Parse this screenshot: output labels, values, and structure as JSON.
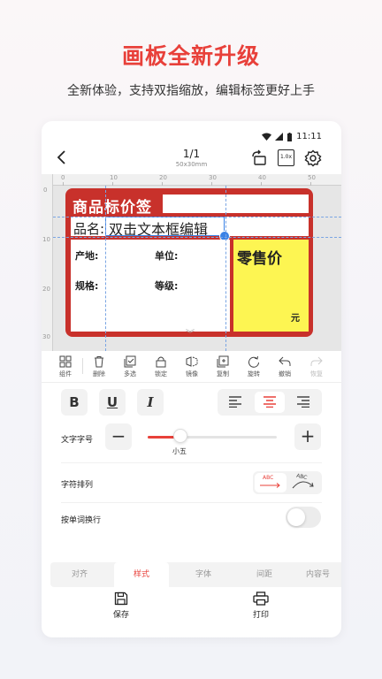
{
  "promo": {
    "headline": "画板全新升级",
    "subhead": "全新体验，支持双指缩放，编辑标签更好上手"
  },
  "status_bar": {
    "time": "11:11"
  },
  "topbar": {
    "page": "1/1",
    "size": "50x30mm",
    "zoom_badge": "1.0x",
    "icons": [
      "back-icon",
      "replace-template-icon",
      "zoom-level-icon",
      "settings-gear-icon"
    ]
  },
  "rulers": {
    "top": [
      "0",
      "10",
      "20",
      "30",
      "40",
      "50"
    ],
    "left": [
      "0",
      "10",
      "20",
      "30"
    ]
  },
  "label": {
    "title": "商品标价签",
    "name_label": "品名:",
    "editing_text": "双击文本框编辑",
    "fields": {
      "origin": "产地:",
      "unit": "单位:",
      "spec": "规格:",
      "grade": "等级:"
    },
    "price_title": "零售价",
    "price_unit": "元",
    "colors": {
      "frame": "#c8312b",
      "price_bg": "#fdf552",
      "selection": "#3a82e6"
    }
  },
  "toolbar": {
    "items": [
      {
        "label": "组件",
        "icon": "components-grid-icon",
        "enabled": true
      },
      {
        "label": "删除",
        "icon": "trash-icon",
        "enabled": true
      },
      {
        "label": "多选",
        "icon": "multi-select-icon",
        "enabled": true
      },
      {
        "label": "锁定",
        "icon": "lock-icon",
        "enabled": true
      },
      {
        "label": "镜像",
        "icon": "mirror-icon",
        "enabled": true
      },
      {
        "label": "复制",
        "icon": "copy-icon",
        "enabled": true
      },
      {
        "label": "旋转",
        "icon": "rotate-icon",
        "enabled": true
      },
      {
        "label": "撤销",
        "icon": "undo-icon",
        "enabled": true
      },
      {
        "label": "恢复",
        "icon": "redo-icon",
        "enabled": false
      }
    ]
  },
  "format": {
    "bold": "B",
    "underline": "U",
    "italic": "I",
    "alignment_selected": "center"
  },
  "font_size": {
    "label": "文字字号",
    "value": "小五",
    "level": 0.25,
    "minus": "−",
    "plus": "+"
  },
  "arrangement": {
    "label": "字符排列",
    "options": [
      "ABC",
      "ABC"
    ],
    "selected": "horizontal"
  },
  "word_wrap": {
    "label": "按单词换行",
    "enabled": false
  },
  "tabs": {
    "items": [
      "对齐",
      "样式",
      "字体",
      "间距",
      "内容号"
    ],
    "active": "样式"
  },
  "bottom_actions": {
    "save": "保存",
    "print": "打印"
  },
  "accent_color": "#e8403a"
}
